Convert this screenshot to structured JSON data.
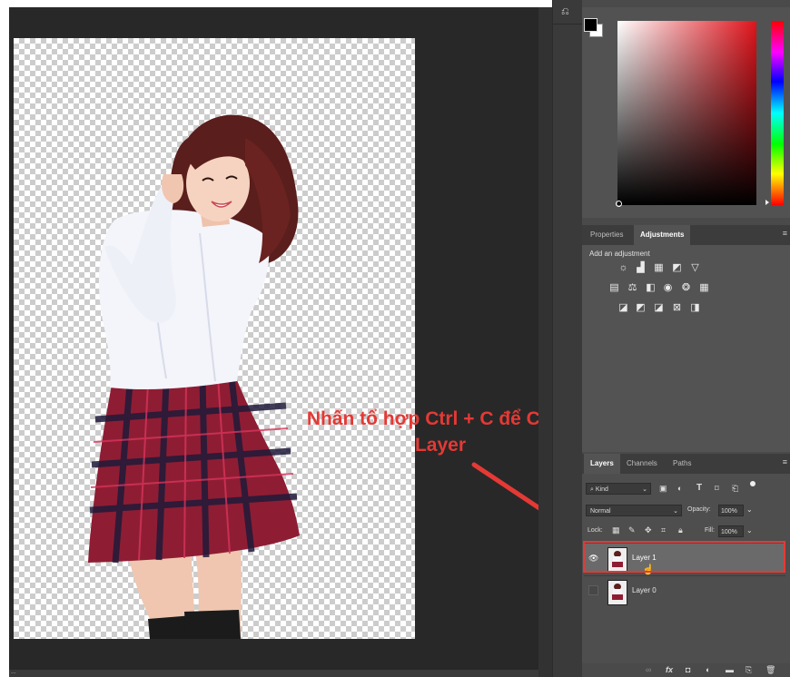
{
  "status": {
    "zoom_text": "..."
  },
  "annotation": {
    "line1": "Nhấn tổ hợp Ctrl + C để Copy",
    "line2": "Layer",
    "color": "#e53935"
  },
  "adjustments_panel": {
    "tabs": [
      {
        "label": "Properties"
      },
      {
        "label": "Adjustments"
      }
    ],
    "active_tab": "Adjustments",
    "hint": "Add an adjustment",
    "row1": [
      "brightness-icon",
      "levels-icon",
      "curves-icon",
      "exposure-icon",
      "gradient-triangle-icon"
    ],
    "row2": [
      "vibrance-icon",
      "color-balance-icon",
      "black-white-icon",
      "photo-filter-icon",
      "channel-mixer-icon",
      "color-lookup-icon"
    ],
    "row3": [
      "invert-icon",
      "posterize-icon",
      "threshold-icon",
      "selective-color-icon",
      "gradient-map-icon"
    ]
  },
  "layers_panel": {
    "tabs": [
      {
        "label": "Layers"
      },
      {
        "label": "Channels"
      },
      {
        "label": "Paths"
      }
    ],
    "active_tab": "Layers",
    "filter_kind": "Kind",
    "blend_mode": "Normal",
    "opacity_label": "Opacity:",
    "opacity_value": "100%",
    "lock_label": "Lock:",
    "fill_label": "Fill:",
    "fill_value": "100%",
    "layers": [
      {
        "name": "Layer 1",
        "visible": true,
        "selected": true
      },
      {
        "name": "Layer 0",
        "visible": false,
        "selected": false
      }
    ],
    "footer_icons": [
      "link-icon",
      "fx-icon",
      "mask-icon",
      "adjustment-layer-icon",
      "folder-icon",
      "new-layer-icon",
      "trash-icon"
    ]
  },
  "colors": {
    "highlight_border": "#e53935",
    "skirt_red": "#8e1d33",
    "skirt_dark": "#1f1a3a",
    "hair": "#5a1e1c",
    "shirt": "#f4f5fb"
  }
}
